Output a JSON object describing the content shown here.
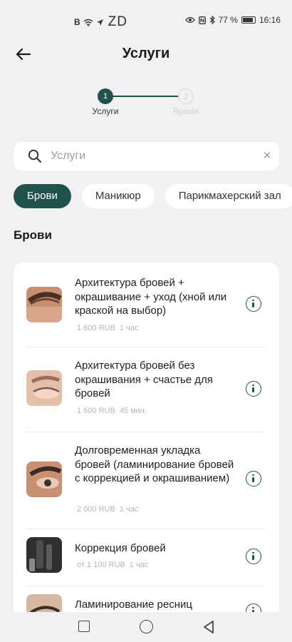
{
  "status_bar": {
    "left_icons": [
      "b-icon",
      "wifi-icon",
      "send-icon"
    ],
    "carrier": "ZD",
    "battery": "77 %",
    "time": "16:16"
  },
  "header": {
    "title": "Услуги"
  },
  "stepper": {
    "steps": [
      {
        "number": "1",
        "label": "Услуги",
        "active": true
      },
      {
        "number": "2",
        "label": "Время",
        "active": false
      }
    ]
  },
  "search": {
    "placeholder": "Услуги",
    "value": ""
  },
  "categories": [
    "Брови",
    "Маникюр",
    "Парикмахерский зал"
  ],
  "section_title": "Брови",
  "services": [
    {
      "name": "Архитектура бровей + окрашивание + уход (хной или краской на выбор)",
      "price": "1 600 RUB",
      "duration": "1 час"
    },
    {
      "name": "Архитектура бровей без окрашивания + счастье для бровей",
      "price": "1 600 RUB",
      "duration": "45 мин."
    },
    {
      "name": "Долговременная укладка бровей (ламинирование бровей с коррекцией и окрашиванием)",
      "price": "2 000 RUB",
      "duration": "1 час"
    },
    {
      "name": "Коррекция бровей",
      "price": "от 1 100 RUB",
      "duration": "1 час"
    },
    {
      "name": "Ламинирование ресниц",
      "price": "",
      "duration": ""
    }
  ],
  "colors": {
    "accent": "#21524c",
    "background": "#f1f1f3",
    "card": "#ffffff",
    "meta_text": "#b4b4b4"
  }
}
